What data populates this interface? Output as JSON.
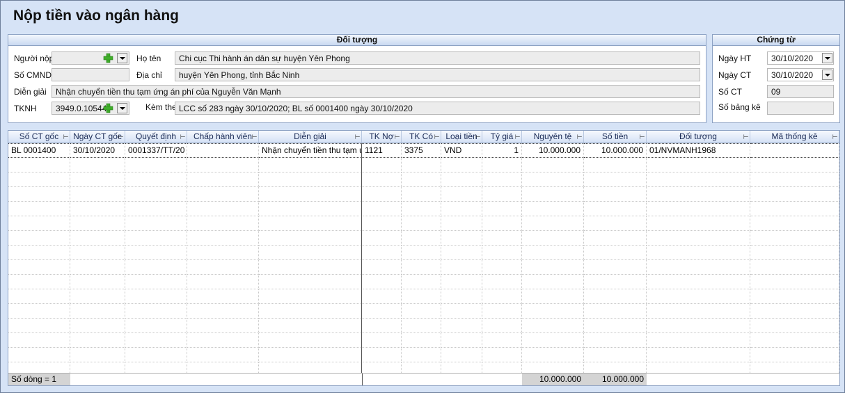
{
  "window": {
    "title": "Nộp tiền vào ngân hàng"
  },
  "doi_tuong": {
    "header": "Đối tượng",
    "nguoi_nop_label": "Người nộp",
    "nguoi_nop_value": "",
    "so_cmnd_label": "Số CMND",
    "so_cmnd_value": "",
    "dien_giai_label": "Diễn giải",
    "dien_giai_value": "Nhận chuyển tiền thu tạm ứng án phí của Nguyễn Văn Mạnh",
    "tknh_label": "TKNH",
    "tknh_value": "3949.0.10544",
    "ho_ten_label": "Họ tên",
    "ho_ten_value": "Chi cục Thi hành án dân sự huyện Yên Phong",
    "dia_chi_label": "Địa chỉ",
    "dia_chi_value": "huyện Yên Phong, tỉnh Bắc Ninh",
    "kem_theo_label": "Kèm theo",
    "kem_theo_value": "LCC số 283 ngày 30/10/2020; BL số 0001400 ngày 30/10/2020"
  },
  "chung_tu": {
    "header": "Chứng từ",
    "ngay_ht_label": "Ngày HT",
    "ngay_ht_value": "30/10/2020",
    "ngay_ct_label": "Ngày CT",
    "ngay_ct_value": "30/10/2020",
    "so_ct_label": "Số CT",
    "so_ct_value": "09",
    "so_bang_ke_label": "Số bảng kê",
    "so_bang_ke_value": ""
  },
  "grid": {
    "columns": [
      "Số CT gốc",
      "Ngày CT gốc",
      "Quyết định",
      "Chấp hành viên",
      "Diễn giải",
      "TK Nợ",
      "TK Có",
      "Loại tiền",
      "Tỷ giá",
      "Nguyên tệ",
      "Số tiền",
      "Đối tượng",
      "Mã thống kê"
    ],
    "rows": [
      [
        "BL 0001400",
        "30/10/2020",
        "0001337/TT/20",
        "",
        "Nhận chuyển tiền thu tạm ứ",
        "1121",
        "3375",
        "VND",
        "1",
        "10.000.000",
        "10.000.000",
        "01/NVMANH1968",
        ""
      ]
    ],
    "footer": {
      "row_count": "Số dòng = 1",
      "nguyen_te_total": "10.000.000",
      "so_tien_total": "10.000.000"
    }
  },
  "colors": {
    "background": "#d6e3f6",
    "border": "#8da2c4",
    "header_text": "#1a2a55"
  }
}
